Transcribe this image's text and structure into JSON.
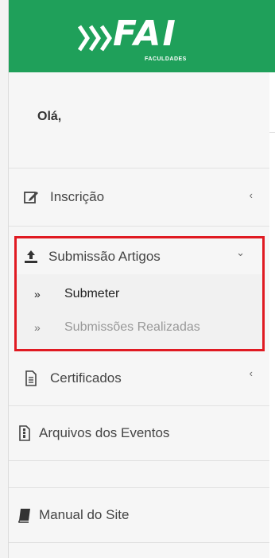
{
  "brand": {
    "name": "FAI",
    "subtitle": "FACULDADES",
    "color": "#1fa05a"
  },
  "user": {
    "greeting": "Olá,"
  },
  "menu": {
    "inscricao": {
      "label": "Inscrição",
      "icon": "edit-icon",
      "chevron": "‹"
    },
    "submissao": {
      "label": "Submissão Artigos",
      "icon": "upload-icon",
      "chevron": "⌄",
      "children": [
        {
          "label": "Submeter",
          "marker": "»"
        },
        {
          "label": "Submissões Realizadas",
          "marker": "»"
        }
      ]
    },
    "certificados": {
      "label": "Certificados",
      "icon": "document-icon",
      "chevron": "‹"
    },
    "arquivos": {
      "label": "Arquivos dos Eventos",
      "icon": "file-archive-icon"
    },
    "manual": {
      "label": "Manual do Site",
      "icon": "book-icon"
    }
  },
  "highlight_color": "#e01a22"
}
